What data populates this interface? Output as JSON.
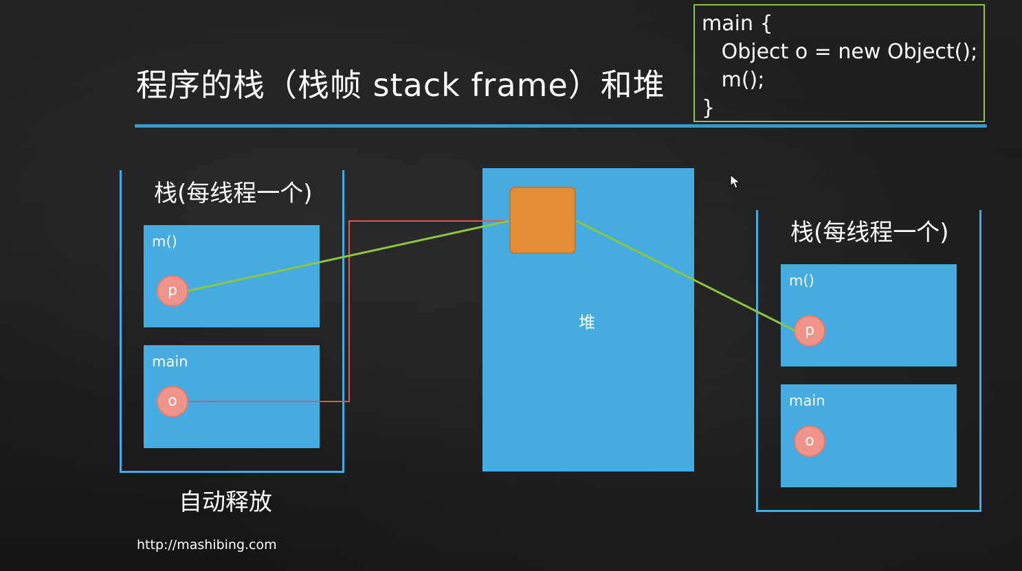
{
  "title": "程序的栈（栈帧 stack frame）和堆",
  "code": {
    "lines": [
      "main {",
      "   Object o = new Object();",
      "   m();",
      "}"
    ]
  },
  "left_stack": {
    "label": "栈(每线程一个)",
    "frames": [
      {
        "name": "m()",
        "var": "p"
      },
      {
        "name": "main",
        "var": "o"
      }
    ],
    "footer": "自动释放"
  },
  "heap": {
    "label": "堆"
  },
  "right_stack": {
    "label": "栈(每线程一个)",
    "frames": [
      {
        "name": "m()",
        "var": "p"
      },
      {
        "name": "main",
        "var": "o"
      }
    ]
  },
  "url": "http://mashibing.com",
  "colors": {
    "frame_blue": "#44ace0",
    "object_orange": "#e28c35",
    "var_pink": "#f0948a",
    "link_green": "#8cc63f",
    "link_red": "#e0584a",
    "code_border": "#8cc63f"
  }
}
